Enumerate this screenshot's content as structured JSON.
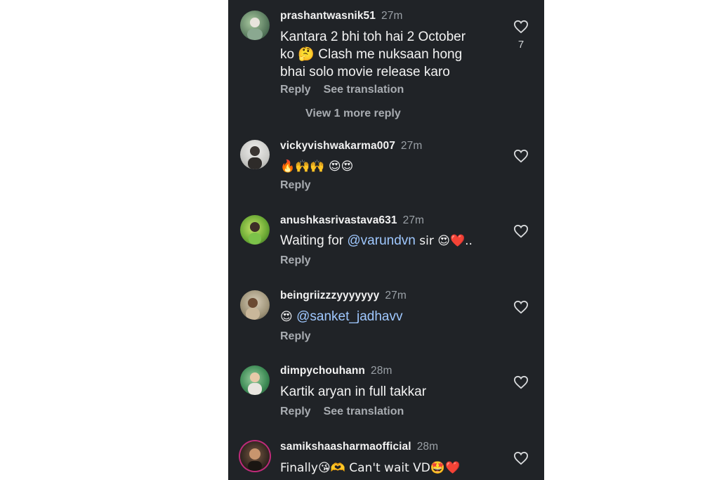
{
  "comments": [
    {
      "username": "prashantwasnik51",
      "time": "27m",
      "text_lines": [
        "Kantara 2 bhi toh hai 2 October",
        "ko 🤔 Clash me nuksaan hong",
        "bhai solo movie release karo"
      ],
      "reply": "Reply",
      "translate": "See translation",
      "likes": "7",
      "avatar_color": "#6b8f6a"
    },
    {
      "username": "vickyvishwakarma007",
      "time": "27m",
      "text": "🔥🙌🙌 😍😍",
      "reply": "Reply",
      "avatar_color": "#cfcfcf"
    },
    {
      "username": "anushkasrivastava631",
      "time": "27m",
      "text_prefix": "Waiting for ",
      "mention": "@varundvn",
      "text_suffix": " sir 😍❤️..",
      "reply": "Reply",
      "avatar_color": "#7fc24a"
    },
    {
      "username": "beingriizzzyyyyyyy",
      "time": "27m",
      "text_prefix": "😍 ",
      "mention": "@sanket_jadhavv",
      "reply": "Reply",
      "avatar_color": "#a89a80"
    },
    {
      "username": "dimpychouhann",
      "time": "28m",
      "text": "Kartik aryan in full takkar",
      "reply": "Reply",
      "translate": "See translation",
      "avatar_color": "#3b8c5a"
    },
    {
      "username": "samikshaasharmaofficial",
      "time": "28m",
      "text": "Finally😘🫶 Can't wait VD🤩❤️",
      "avatar_color": "#2a2320"
    }
  ],
  "view_more": "View 1 more reply",
  "icons": {
    "like": "heart-icon"
  }
}
